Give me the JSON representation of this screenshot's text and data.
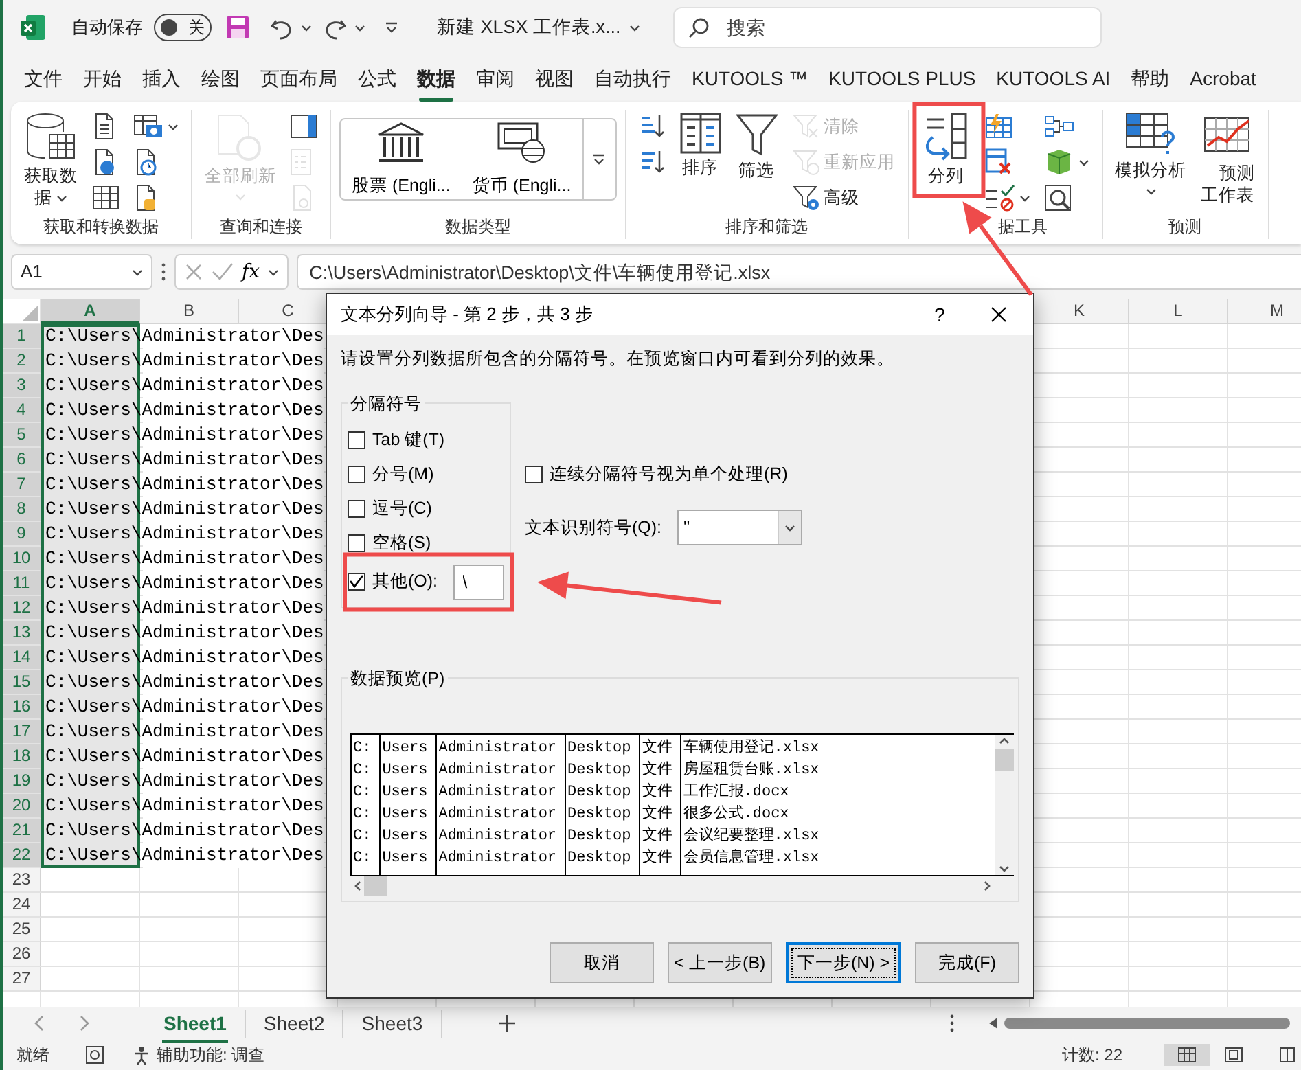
{
  "title_bar": {
    "autosave_label": "自动保存",
    "autosave": {
      "on": false,
      "label": "关"
    },
    "file_name": "新建 XLSX 工作表.x...",
    "search": {
      "placeholder": "搜索"
    }
  },
  "menu_tabs": [
    {
      "label": "文件",
      "selected": false
    },
    {
      "label": "开始",
      "selected": false
    },
    {
      "label": "插入",
      "selected": false
    },
    {
      "label": "绘图",
      "selected": false
    },
    {
      "label": "页面布局",
      "selected": false
    },
    {
      "label": "公式",
      "selected": false
    },
    {
      "label": "数据",
      "selected": true
    },
    {
      "label": "审阅",
      "selected": false
    },
    {
      "label": "视图",
      "selected": false
    },
    {
      "label": "自动执行",
      "selected": false
    },
    {
      "label": "KUTOOLS ™",
      "selected": false
    },
    {
      "label": "KUTOOLS PLUS",
      "selected": false
    },
    {
      "label": "KUTOOLS AI",
      "selected": false
    },
    {
      "label": "帮助",
      "selected": false
    },
    {
      "label": "Acrobat",
      "selected": false
    }
  ],
  "ribbon": {
    "groups": [
      {
        "label": "获取和转换数据",
        "buttons": [
          {
            "kind": "large",
            "label": "获取数据",
            "dropdown": true,
            "disabled": false
          },
          {
            "kind": "small",
            "disabled": false
          },
          {
            "kind": "small",
            "disabled": false
          },
          {
            "kind": "small",
            "disabled": false
          },
          {
            "kind": "small",
            "dropdown": true,
            "disabled": false
          },
          {
            "kind": "small",
            "disabled": false
          },
          {
            "kind": "small",
            "disabled": false
          }
        ]
      },
      {
        "label": "查询和连接",
        "buttons": [
          {
            "kind": "large",
            "label": "全部刷新",
            "dropdown": true,
            "disabled": true
          },
          {
            "kind": "small",
            "disabled": false
          },
          {
            "kind": "small",
            "disabled": true
          },
          {
            "kind": "small",
            "disabled": true
          }
        ]
      },
      {
        "label": "数据类型",
        "buttons": [
          {
            "kind": "gallery",
            "label": "股票 (Engli..."
          },
          {
            "kind": "gallery",
            "label": "货币 (Engli..."
          },
          {
            "kind": "gallery-more"
          }
        ]
      },
      {
        "label": "排序和筛选",
        "buttons": [
          {
            "kind": "small",
            "disabled": false
          },
          {
            "kind": "small",
            "disabled": false
          },
          {
            "kind": "large",
            "label": "排序",
            "disabled": false
          },
          {
            "kind": "large",
            "label": "筛选",
            "disabled": false
          },
          {
            "kind": "small",
            "label": "清除",
            "disabled": true
          },
          {
            "kind": "small",
            "label": "重新应用",
            "disabled": true
          },
          {
            "kind": "small",
            "label": "高级",
            "disabled": false
          }
        ]
      },
      {
        "label": "据工具",
        "buttons": [
          {
            "kind": "large",
            "label": "分列",
            "disabled": false
          },
          {
            "kind": "small",
            "disabled": false
          },
          {
            "kind": "small",
            "disabled": false
          },
          {
            "kind": "small",
            "dropdown": true,
            "disabled": false
          },
          {
            "kind": "small",
            "disabled": false
          },
          {
            "kind": "small",
            "dropdown": true,
            "disabled": false
          },
          {
            "kind": "small",
            "disabled": false
          }
        ]
      },
      {
        "label": "预测",
        "buttons": [
          {
            "kind": "large",
            "label": "模拟分析",
            "dropdown": true,
            "disabled": false
          },
          {
            "kind": "large",
            "label": "预测工作表",
            "disabled": false
          }
        ]
      }
    ]
  },
  "formula_bar": {
    "name_box": "A1",
    "fx": "fx",
    "formula": "C:\\Users\\Administrator\\Desktop\\文件\\车辆使用登记.xlsx"
  },
  "sheet": {
    "columns": [
      {
        "label": "A",
        "selected": true
      },
      {
        "label": "B",
        "selected": false
      },
      {
        "label": "C",
        "selected": false
      },
      {
        "label": "K",
        "selected": false
      },
      {
        "label": "L",
        "selected": false
      },
      {
        "label": "M",
        "selected": false
      }
    ],
    "rows": [
      {
        "header": "1",
        "selected": true,
        "value": "C:\\Users\\Administrator\\Des"
      },
      {
        "header": "2",
        "selected": true,
        "value": "C:\\Users\\Administrator\\Des"
      },
      {
        "header": "3",
        "selected": true,
        "value": "C:\\Users\\Administrator\\Des"
      },
      {
        "header": "4",
        "selected": true,
        "value": "C:\\Users\\Administrator\\Des"
      },
      {
        "header": "5",
        "selected": true,
        "value": "C:\\Users\\Administrator\\Des"
      },
      {
        "header": "6",
        "selected": true,
        "value": "C:\\Users\\Administrator\\Des"
      },
      {
        "header": "7",
        "selected": true,
        "value": "C:\\Users\\Administrator\\Des"
      },
      {
        "header": "8",
        "selected": true,
        "value": "C:\\Users\\Administrator\\Des"
      },
      {
        "header": "9",
        "selected": true,
        "value": "C:\\Users\\Administrator\\Des"
      },
      {
        "header": "10",
        "selected": true,
        "value": "C:\\Users\\Administrator\\Des"
      },
      {
        "header": "11",
        "selected": true,
        "value": "C:\\Users\\Administrator\\Des"
      },
      {
        "header": "12",
        "selected": true,
        "value": "C:\\Users\\Administrator\\Des"
      },
      {
        "header": "13",
        "selected": true,
        "value": "C:\\Users\\Administrator\\Des"
      },
      {
        "header": "14",
        "selected": true,
        "value": "C:\\Users\\Administrator\\Des"
      },
      {
        "header": "15",
        "selected": true,
        "value": "C:\\Users\\Administrator\\Des"
      },
      {
        "header": "16",
        "selected": true,
        "value": "C:\\Users\\Administrator\\Des"
      },
      {
        "header": "17",
        "selected": true,
        "value": "C:\\Users\\Administrator\\Des"
      },
      {
        "header": "18",
        "selected": true,
        "value": "C:\\Users\\Administrator\\Des"
      },
      {
        "header": "19",
        "selected": true,
        "value": "C:\\Users\\Administrator\\Des"
      },
      {
        "header": "20",
        "selected": true,
        "value": "C:\\Users\\Administrator\\Des"
      },
      {
        "header": "21",
        "selected": true,
        "value": "C:\\Users\\Administrator\\Des"
      },
      {
        "header": "22",
        "selected": true,
        "value": "C:\\Users\\Administrator\\Des"
      },
      {
        "header": "23",
        "selected": false
      },
      {
        "header": "24",
        "selected": false
      },
      {
        "header": "25",
        "selected": false
      },
      {
        "header": "26",
        "selected": false
      },
      {
        "header": "27",
        "selected": false
      }
    ]
  },
  "dialog": {
    "title": "文本分列向导 - 第 2 步，共 3 步",
    "help": "?",
    "instruction": "请设置分列数据所包含的分隔符号。在预览窗口内可看到分列的效果。",
    "delimiters": {
      "legend": "分隔符号",
      "options": [
        {
          "label": "Tab 键(T)",
          "checked": false
        },
        {
          "label": "分号(M)",
          "checked": false
        },
        {
          "label": "逗号(C)",
          "checked": false
        },
        {
          "label": "空格(S)",
          "checked": false
        },
        {
          "label": "其他(O):",
          "checked": true,
          "value": "\\"
        }
      ]
    },
    "consecutive": {
      "label": "连续分隔符号视为单个处理(R)",
      "checked": false
    },
    "qualifier": {
      "label": "文本识别符号(Q):",
      "value": "\""
    },
    "preview": {
      "legend": "数据预览(P)",
      "rows": [
        [
          "C:",
          "Users",
          "Administrator",
          "Desktop",
          "文件",
          "车辆使用登记.xlsx"
        ],
        [
          "C:",
          "Users",
          "Administrator",
          "Desktop",
          "文件",
          "房屋租赁台账.xlsx"
        ],
        [
          "C:",
          "Users",
          "Administrator",
          "Desktop",
          "文件",
          "工作汇报.docx"
        ],
        [
          "C:",
          "Users",
          "Administrator",
          "Desktop",
          "文件",
          "很多公式.docx"
        ],
        [
          "C:",
          "Users",
          "Administrator",
          "Desktop",
          "文件",
          "会议纪要整理.xlsx"
        ],
        [
          "C:",
          "Users",
          "Administrator",
          "Desktop",
          "文件",
          "会员信息管理.xlsx"
        ]
      ]
    },
    "buttons": [
      {
        "label": "取消",
        "default": false
      },
      {
        "label": "< 上一步(B)",
        "default": false
      },
      {
        "label": "下一步(N) >",
        "default": true
      },
      {
        "label": "完成(F)",
        "default": false
      }
    ]
  },
  "sheet_tabs": [
    {
      "label": "Sheet1",
      "selected": true
    },
    {
      "label": "Sheet2",
      "selected": false
    },
    {
      "label": "Sheet3",
      "selected": false
    }
  ],
  "status_bar": {
    "status": "就绪",
    "accessibility": "辅助功能: 调查",
    "count": "计数: 22"
  }
}
